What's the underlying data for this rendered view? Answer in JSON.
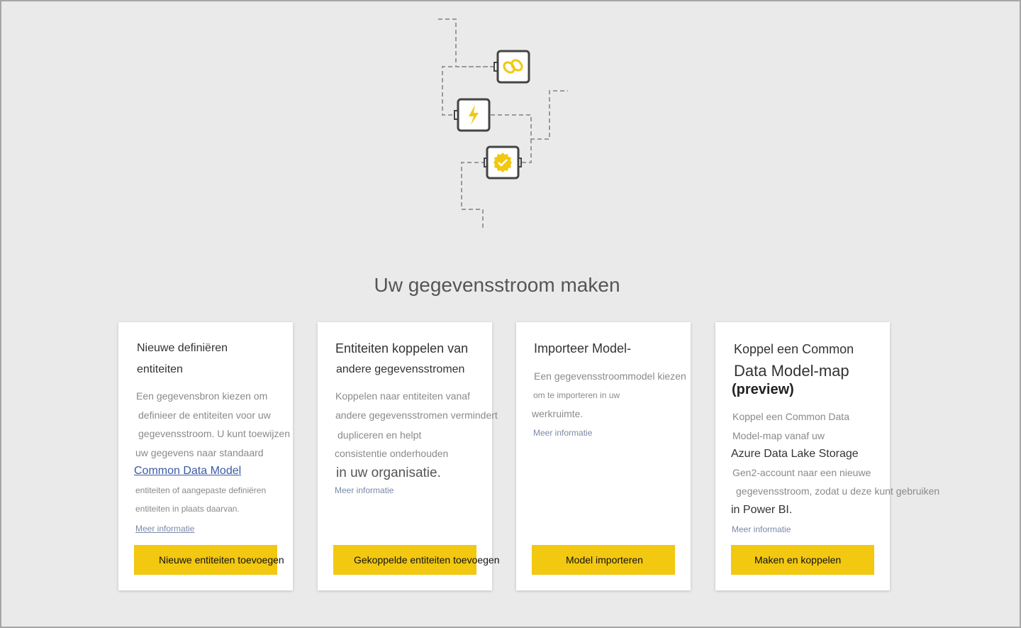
{
  "page": {
    "title": "Uw gegevensstroom maken"
  },
  "colors": {
    "accent": "#f2c811",
    "background": "#eaeaea",
    "card": "#ffffff",
    "link": "#3b5ba5"
  },
  "illustration": {
    "icons": [
      "link-icon",
      "lightning-icon",
      "check-badge-icon"
    ]
  },
  "cards": [
    {
      "title_lines": [
        "Nieuwe definiëren",
        "entiteiten"
      ],
      "desc_lines": [
        "Een gegevensbron kiezen om",
        "definieer de entiteiten voor uw",
        "gegevensstroom. U kunt toewijzen",
        "uw gegevens naar standaard"
      ],
      "cdm_link": "Common Data Model",
      "desc_lines_2": [
        "entiteiten of aangepaste definiëren",
        "entiteiten in plaats daarvan."
      ],
      "more_info": "Meer informatie",
      "button": "Nieuwe entiteiten toevoegen"
    },
    {
      "title_lines": [
        "Entiteiten koppelen van",
        "andere  gegevensstromen"
      ],
      "desc_lines": [
        "Koppelen naar entiteiten vanaf",
        "andere gegevensstromen vermindert",
        "dupliceren en helpt",
        "consistentie onderhouden",
        "in uw organisatie."
      ],
      "more_info": "Meer informatie",
      "button": "Gekoppelde entiteiten toevoegen"
    },
    {
      "title_lines": [
        "Importeer Model-"
      ],
      "desc_lines": [
        "Een gegevensstroommodel kiezen",
        "om te importeren in uw",
        "werkruimte."
      ],
      "more_info": "Meer informatie",
      "button": "Model importeren"
    },
    {
      "title_lines": [
        "Koppel een Common",
        "Data Model-map",
        "(preview)"
      ],
      "desc_lines": [
        "Koppel een Common Data",
        "Model-map vanaf uw",
        "Azure Data Lake Storage",
        "Gen2-account naar een nieuwe",
        "gegevensstroom, zodat u deze kunt gebruiken",
        "in Power BI."
      ],
      "more_info": "Meer informatie",
      "button": "Maken en koppelen"
    }
  ]
}
